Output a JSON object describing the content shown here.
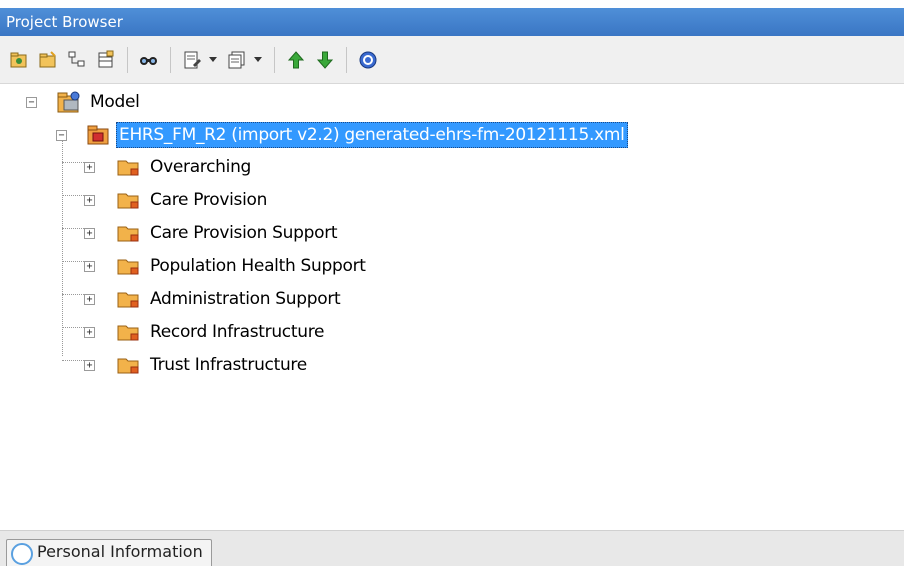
{
  "panel": {
    "title": "Project Browser"
  },
  "toolbar": {
    "buttons": [
      {
        "icon": "new-root-package-icon"
      },
      {
        "icon": "new-package-icon"
      },
      {
        "icon": "new-diagram-icon"
      },
      {
        "icon": "new-element-icon"
      },
      {
        "icon": "find-in-project-icon"
      },
      {
        "icon": "edit-properties-icon"
      },
      {
        "icon": "view-options-icon"
      },
      {
        "icon": "move-up-icon"
      },
      {
        "icon": "move-down-icon"
      },
      {
        "icon": "help-icon"
      }
    ]
  },
  "tree": {
    "root": {
      "label": "Model",
      "expander": "⊟"
    },
    "package": {
      "label": "EHRS_FM_R2 (import v2.2) generated-ehrs-fm-20121115.xml",
      "expander": "⊟"
    },
    "folders": [
      {
        "label": "Overarching",
        "expander": "+"
      },
      {
        "label": "Care Provision",
        "expander": "+"
      },
      {
        "label": "Care Provision Support",
        "expander": "+"
      },
      {
        "label": "Population Health Support",
        "expander": "+"
      },
      {
        "label": "Administration Support",
        "expander": "+"
      },
      {
        "label": "Record Infrastructure",
        "expander": "+"
      },
      {
        "label": "Trust Infrastructure",
        "expander": "+"
      }
    ]
  },
  "bottom": {
    "tab_label": "Personal Information"
  },
  "colors": {
    "title_bar": "#3a76c4",
    "selection": "#3399ff",
    "folder": "#f2b24a"
  }
}
